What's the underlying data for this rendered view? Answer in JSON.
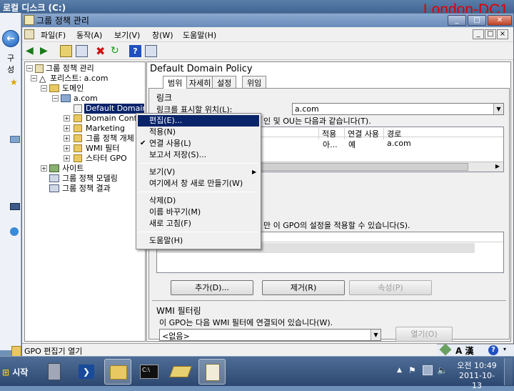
{
  "outer_window": {
    "title": "로컬 디스크 (C:)",
    "side_label": "구성"
  },
  "server_label": "London-DC1",
  "mmc": {
    "title": "그룹 정책 관리",
    "menus": [
      "파일(F)",
      "동작(A)",
      "보기(V)",
      "창(W)",
      "도움말(H)"
    ],
    "window_controls": [
      "_",
      "□",
      "×"
    ]
  },
  "tree": {
    "root": "그룹 정책 관리",
    "forest": "포리스트: a.com",
    "domains": "도메인",
    "domain": "a.com",
    "items": [
      "Default Domain",
      "Domain Cont",
      "Marketing",
      "그룹 정책 개체",
      "WMI 필터",
      "스타터 GPO"
    ],
    "sites": "사이트",
    "modeling": "그룹 정책 모델링",
    "results": "그룹 정책 결과"
  },
  "right_pane": {
    "title": "Default Domain Policy",
    "tabs": [
      "범위",
      "자세히",
      "설정",
      "위임"
    ],
    "links_heading": "링크",
    "links_location_label": "링크를 표시할 위치(L):",
    "links_location_value": "a.com",
    "links_desc_partial": "인 및 OU는 다음과 같습니다(T).",
    "link_columns": [
      "적용",
      "연결 사용",
      "경로"
    ],
    "link_row": {
      "enforced": "아...",
      "link_enabled": "예",
      "path": "a.com"
    },
    "security_desc_partial": "만 이 GPO의 설정을 적용할 수 있습니다(S).",
    "buttons": {
      "add": "추가(D)...",
      "remove": "제거(R)",
      "properties": "속성(P)"
    },
    "wmi_heading": "WMI 필터링",
    "wmi_desc": "이 GPO는 다음 WMI 필터에 연결되어 있습니다(W).",
    "wmi_value": "<없음>",
    "wmi_open": "열기(O)"
  },
  "context_menu": {
    "items": [
      {
        "label": "편집(E)...",
        "selected": true
      },
      {
        "label": "적용(N)"
      },
      {
        "label": "연결 사용(L)",
        "checked": true
      },
      {
        "label": "보고서 저장(S)..."
      },
      {
        "label": "보기(V)",
        "submenu": true
      },
      {
        "label": "여기에서 창 새로 만들기(W)"
      },
      {
        "label": "삭제(D)"
      },
      {
        "label": "이름 바꾸기(M)"
      },
      {
        "label": "새로 고침(F)"
      },
      {
        "label": "도움말(H)"
      }
    ]
  },
  "status_bar": {
    "text": "GPO 편집기 열기",
    "ime": "A 漢"
  },
  "taskbar": {
    "start_label": "시작",
    "clock_time": "오전 10:49",
    "clock_date": "2011-10-13"
  },
  "colors": {
    "selection": "#0a246a",
    "server_label": "#e00000",
    "taskbar": "#2d4870"
  }
}
